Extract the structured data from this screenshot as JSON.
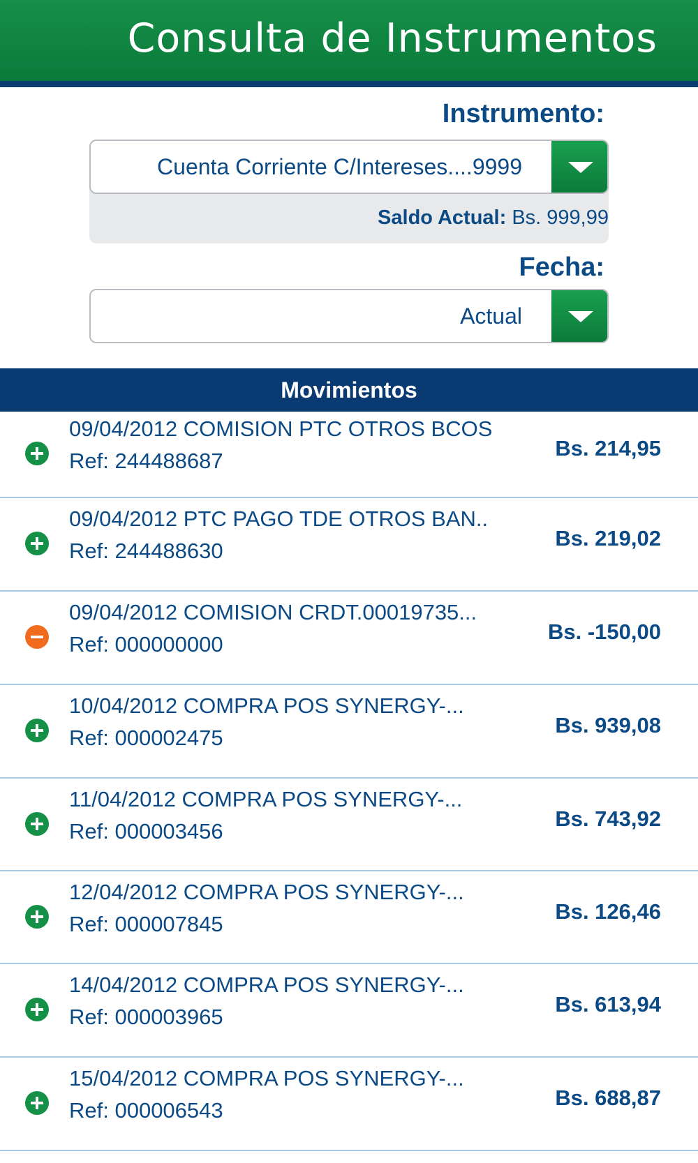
{
  "header": {
    "title": "Consulta de Instrumentos"
  },
  "instrumento": {
    "label": "Instrumento:",
    "value": "Cuenta Corriente C/Intereses....9999",
    "saldo_label": "Saldo Actual:",
    "saldo_value": "Bs. 999,99"
  },
  "fecha": {
    "label": "Fecha:",
    "value": "Actual"
  },
  "movimientos": {
    "title": "Movimientos",
    "items": [
      {
        "type": "plus",
        "desc": "09/04/2012 COMISION PTC OTROS BCOS",
        "ref": "Ref: 244488687",
        "amount": "Bs. 214,95"
      },
      {
        "type": "plus",
        "desc": "09/04/2012 PTC PAGO TDE OTROS BAN..",
        "ref": "Ref: 244488630",
        "amount": "Bs. 219,02"
      },
      {
        "type": "minus",
        "desc": "09/04/2012 COMISION CRDT.00019735...",
        "ref": "Ref: 000000000",
        "amount": "Bs. -150,00"
      },
      {
        "type": "plus",
        "desc": "10/04/2012 COMPRA POS SYNERGY-...",
        "ref": "Ref: 000002475",
        "amount": "Bs. 939,08"
      },
      {
        "type": "plus",
        "desc": "11/04/2012 COMPRA POS SYNERGY-...",
        "ref": "Ref: 000003456",
        "amount": "Bs. 743,92"
      },
      {
        "type": "plus",
        "desc": "12/04/2012 COMPRA POS SYNERGY-...",
        "ref": "Ref: 000007845",
        "amount": "Bs. 126,46"
      },
      {
        "type": "plus",
        "desc": "14/04/2012 COMPRA POS SYNERGY-...",
        "ref": "Ref: 000003965",
        "amount": "Bs. 613,94"
      },
      {
        "type": "plus",
        "desc": "15/04/2012 COMPRA POS SYNERGY-...",
        "ref": "Ref: 000006543",
        "amount": "Bs. 688,87"
      }
    ]
  }
}
